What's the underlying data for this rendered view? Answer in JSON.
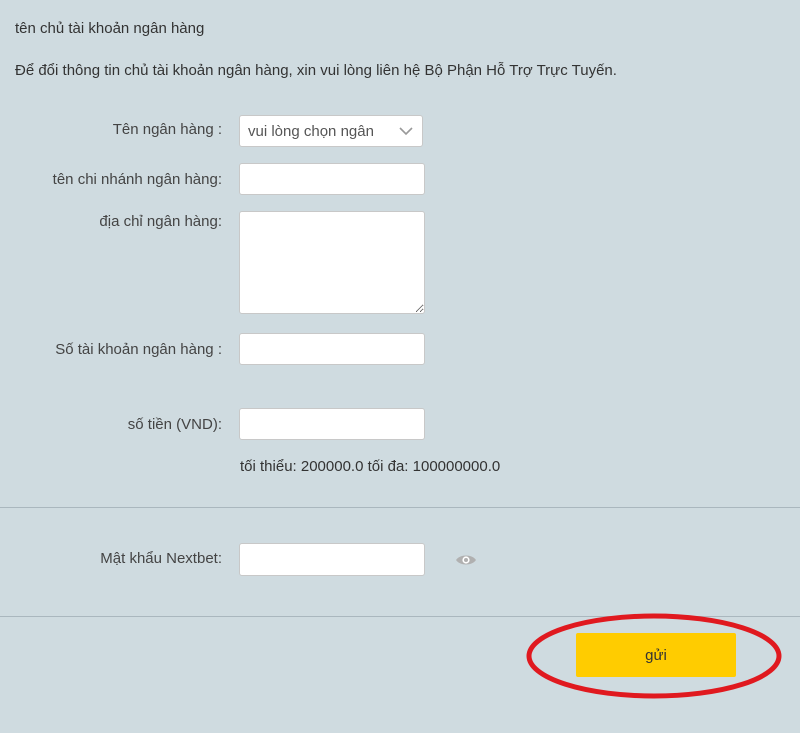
{
  "header": {
    "title": "tên chủ tài khoản ngân hàng",
    "note": "Để đổi thông tin chủ tài khoản ngân hàng, xin vui lòng liên hệ Bộ Phận Hỗ Trợ Trực Tuyến."
  },
  "form": {
    "bank_name": {
      "label": "Tên ngân hàng :",
      "selected": "vui lòng chọn ngân"
    },
    "branch": {
      "label": "tên chi nhánh ngân hàng:",
      "value": ""
    },
    "address": {
      "label": "địa chỉ ngân hàng:",
      "value": ""
    },
    "account_number": {
      "label": "Số tài khoản ngân hàng :",
      "value": ""
    },
    "amount": {
      "label": "số tiền (VND):",
      "value": "",
      "hint": "tối thiểu: 200000.0 tối đa: 100000000.0"
    },
    "password": {
      "label": "Mật khẩu Nextbet:",
      "value": ""
    }
  },
  "submit": {
    "label": "gửi"
  },
  "colors": {
    "background": "#cfdbe0",
    "button": "#ffcc00",
    "highlight": "#e0191f"
  },
  "icons": {
    "select": "chevron-down-icon",
    "password": "eye-icon"
  }
}
